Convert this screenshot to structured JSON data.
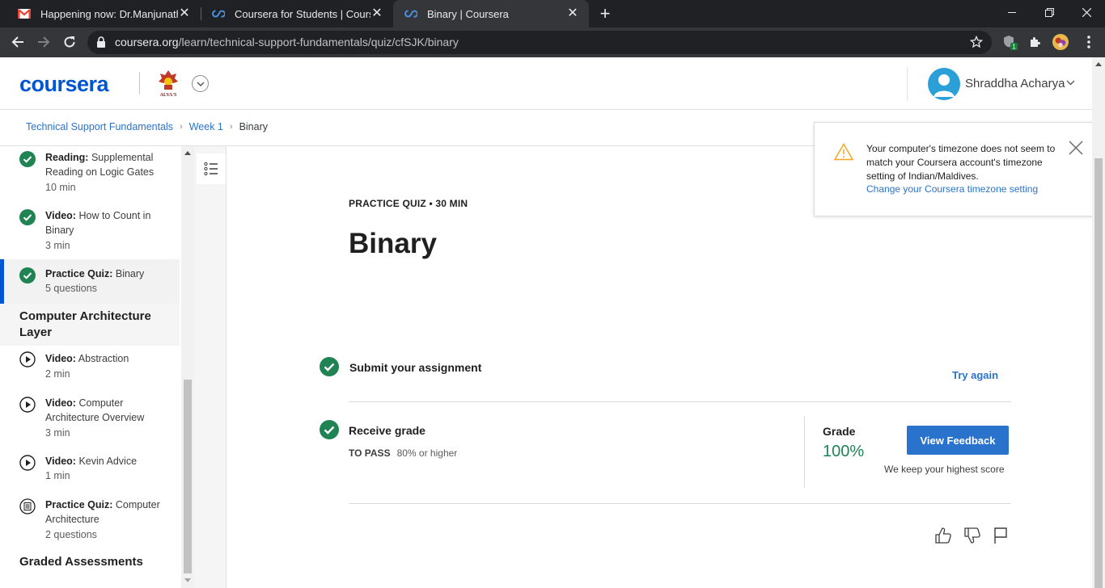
{
  "browser": {
    "tabs": [
      {
        "title": "Happening now: Dr.Manjunath K",
        "favicon": "gmail-icon"
      },
      {
        "title": "Coursera for Students | Coursera",
        "favicon": "coursera-icon"
      },
      {
        "title": "Binary | Coursera",
        "favicon": "coursera-icon",
        "active": true
      }
    ],
    "url_host": "coursera.org",
    "url_path": "/learn/technical-support-fundamentals/quiz/cfSJK/binary",
    "extension_badge": "1"
  },
  "header": {
    "logo_text": "coursera",
    "partner_logo_text": "ALVA'S",
    "user_name": "Shraddha Acharya"
  },
  "breadcrumb": {
    "items": [
      "Technical Support Fundamentals",
      "Week 1"
    ],
    "current": "Binary"
  },
  "sidebar": {
    "items": [
      {
        "type": "Reading:",
        "title": "Supplemental Reading on Logic Gates",
        "meta": "10 min",
        "status": "completed"
      },
      {
        "type": "Video:",
        "title": "How to Count in Binary",
        "meta": "3 min",
        "status": "completed"
      },
      {
        "type": "Practice Quiz:",
        "title": "Binary",
        "meta": "5 questions",
        "status": "completed",
        "current": true
      }
    ],
    "section_title": "Computer Architecture Layer",
    "section_items": [
      {
        "type": "Video:",
        "title": "Abstraction",
        "meta": "2 min",
        "icon": "play-icon"
      },
      {
        "type": "Video:",
        "title": "Computer Architecture Overview",
        "meta": "3 min",
        "icon": "play-icon"
      },
      {
        "type": "Video:",
        "title": "Kevin Advice",
        "meta": "1 min",
        "icon": "play-icon"
      },
      {
        "type": "Practice Quiz:",
        "title": "Computer Architecture",
        "meta": "2 questions",
        "icon": "quiz-icon"
      }
    ],
    "next_section_title": "Graded Assessments"
  },
  "main": {
    "kicker": "PRACTICE QUIZ • 30 MIN",
    "title": "Binary",
    "submit_step": "Submit your assignment",
    "try_again": "Try again",
    "receive_step": "Receive grade",
    "to_pass_label": "TO PASS",
    "to_pass_value": "80% or higher",
    "grade_label": "Grade",
    "grade_value": "100%",
    "view_feedback": "View Feedback",
    "keep_score": "We keep your highest score"
  },
  "toast": {
    "message": "Your computer's timezone does not seem to match your Coursera account's timezone setting of Indian/Maldives.",
    "link": "Change your Coursera timezone setting"
  },
  "colors": {
    "brand_blue": "#0056d2",
    "link_blue": "#2a73cc",
    "success_green": "#1f8354",
    "check_green": "#1f8354"
  }
}
